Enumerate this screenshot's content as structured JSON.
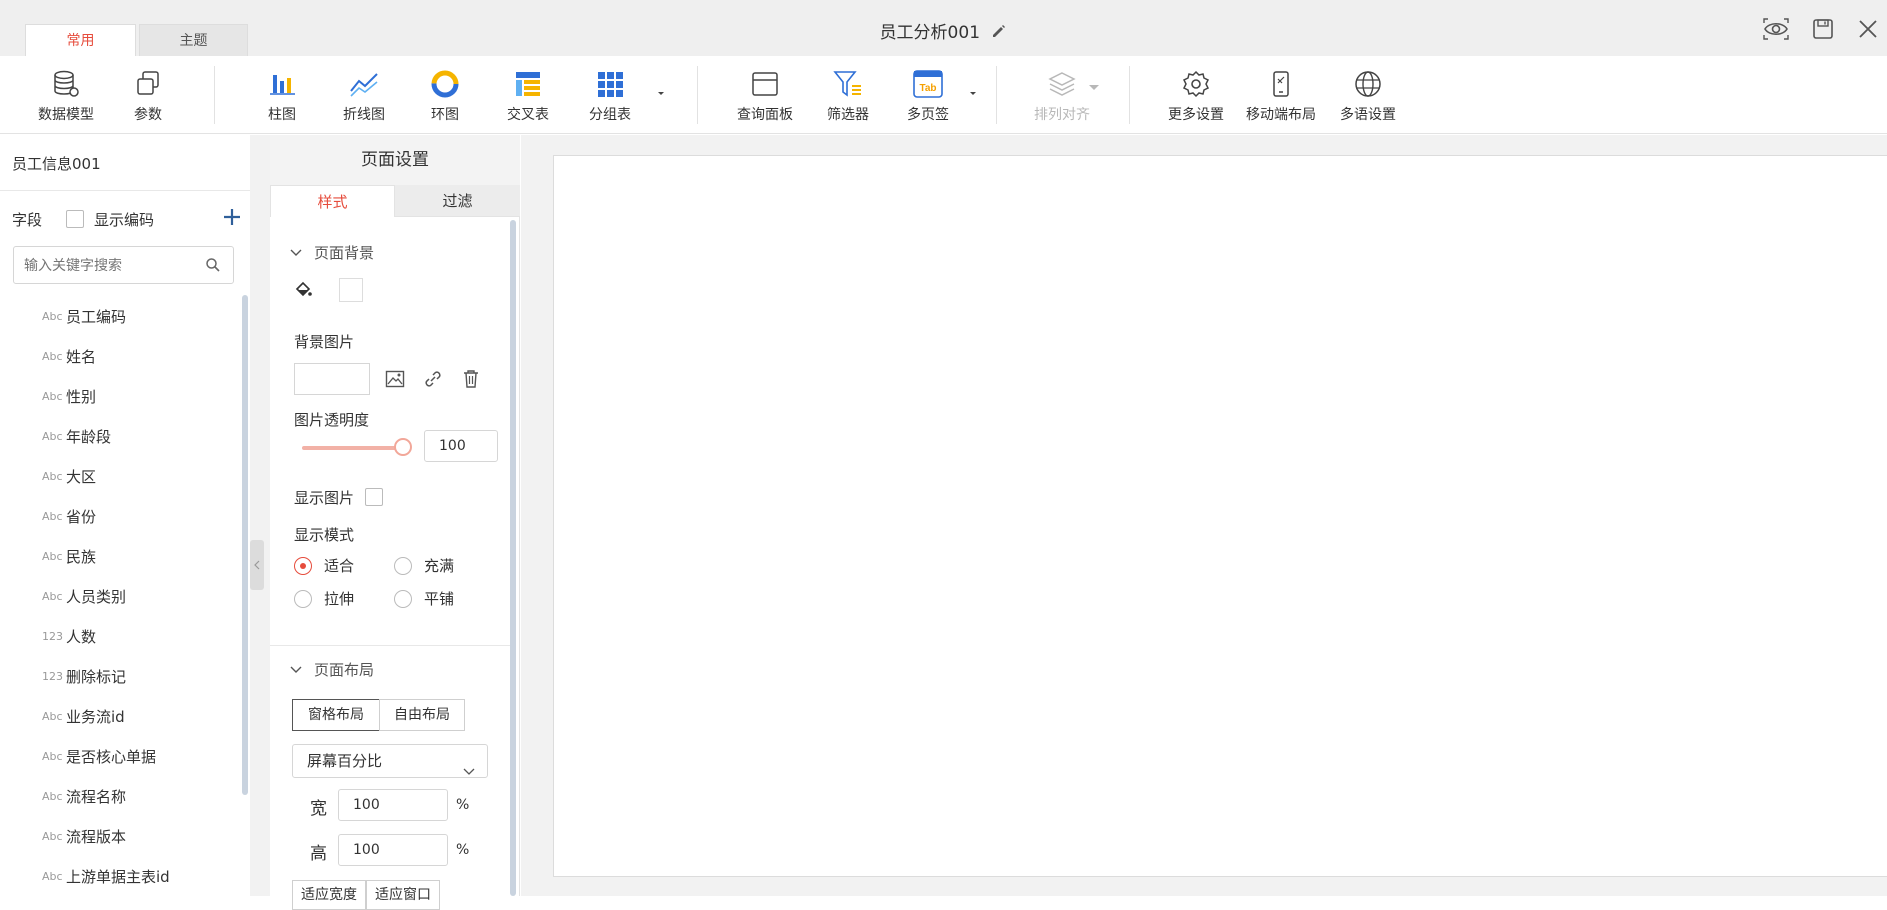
{
  "tabs": [
    {
      "label": "常用",
      "active": true
    },
    {
      "label": "主题",
      "active": false
    }
  ],
  "title": "员工分析001",
  "toolbar": {
    "groups": [
      [
        {
          "label": "数据模型",
          "icon": "database-icon"
        },
        {
          "label": "参数",
          "icon": "parameter-icon"
        }
      ],
      [
        {
          "label": "柱图",
          "icon": "bar-chart-icon"
        },
        {
          "label": "折线图",
          "icon": "line-chart-icon"
        },
        {
          "label": "环图",
          "icon": "donut-chart-icon"
        },
        {
          "label": "交叉表",
          "icon": "crosstab-icon"
        },
        {
          "label": "分组表",
          "icon": "group-table-icon"
        }
      ],
      [
        {
          "label": "查询面板",
          "icon": "query-panel-icon"
        },
        {
          "label": "筛选器",
          "icon": "filter-icon"
        },
        {
          "label": "多页签",
          "icon": "multi-tab-icon"
        }
      ],
      [
        {
          "label": "排列对齐",
          "icon": "layers-icon",
          "disabled": true
        }
      ],
      [
        {
          "label": "更多设置",
          "icon": "gear-icon"
        },
        {
          "label": "移动端布局",
          "icon": "mobile-layout-icon"
        },
        {
          "label": "多语设置",
          "icon": "globe-icon"
        }
      ]
    ],
    "tab_icon_text": "Tab"
  },
  "left_panel": {
    "dataset": "员工信息001",
    "fields_label": "字段",
    "show_code_label": "显示编码",
    "search_placeholder": "输入关键字搜索",
    "fields": [
      {
        "type": "Abc",
        "name": "员工编码"
      },
      {
        "type": "Abc",
        "name": "姓名"
      },
      {
        "type": "Abc",
        "name": "性别"
      },
      {
        "type": "Abc",
        "name": "年龄段"
      },
      {
        "type": "Abc",
        "name": "大区"
      },
      {
        "type": "Abc",
        "name": "省份"
      },
      {
        "type": "Abc",
        "name": "民族"
      },
      {
        "type": "Abc",
        "name": "人员类别"
      },
      {
        "type": "123",
        "name": "人数"
      },
      {
        "type": "123",
        "name": "删除标记"
      },
      {
        "type": "Abc",
        "name": "业务流id"
      },
      {
        "type": "Abc",
        "name": "是否核心单据"
      },
      {
        "type": "Abc",
        "name": "流程名称"
      },
      {
        "type": "Abc",
        "name": "流程版本"
      },
      {
        "type": "Abc",
        "name": "上游单据主表id"
      }
    ]
  },
  "settings": {
    "title": "页面设置",
    "tab_style": "样式",
    "tab_filter": "过滤",
    "bg_section": "页面背景",
    "bg_image": "背景图片",
    "opacity_label": "图片透明度",
    "opacity_value": "100",
    "opacity_fraction": 1.0,
    "show_image": "显示图片",
    "display_mode": "显示模式",
    "modes": [
      "适合",
      "充满",
      "拉伸",
      "平铺"
    ],
    "selected_mode": "适合",
    "layout_section": "页面布局",
    "layout_grid": "窗格布局",
    "layout_free": "自由布局",
    "screen_option": "屏幕百分比",
    "width_label": "宽",
    "height_label": "高",
    "width_value": "100",
    "height_value": "100",
    "unit": "%",
    "fit_width": "适应宽度",
    "fit_window": "适应窗口"
  },
  "colors": {
    "accent": "#e64c3c",
    "brand_blue": "#2f6fd6"
  }
}
